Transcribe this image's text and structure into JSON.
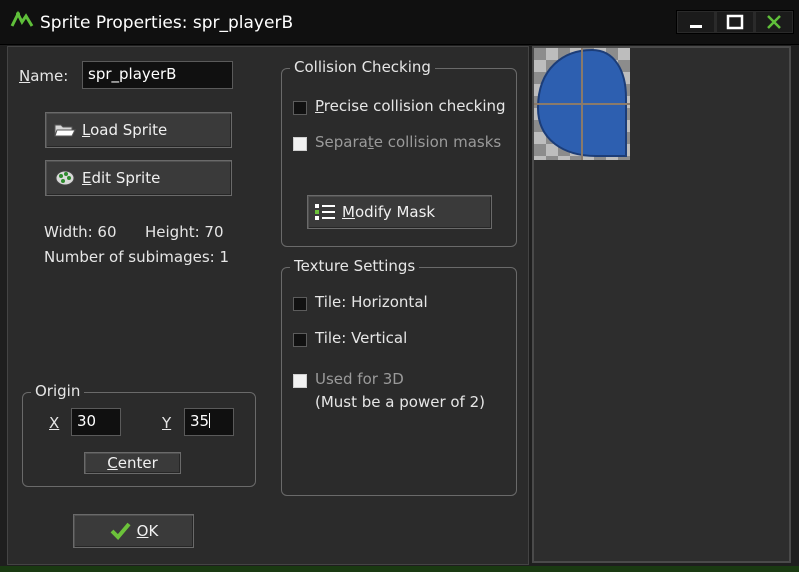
{
  "window": {
    "title": "Sprite Properties: spr_playerB"
  },
  "name_field": {
    "label": "Name:",
    "value": "spr_playerB"
  },
  "buttons": {
    "load_sprite": "Load Sprite",
    "edit_sprite": "Edit Sprite",
    "modify_mask": "Modify Mask",
    "center": "Center",
    "ok": "OK"
  },
  "info": {
    "width": "Width: 60",
    "height": "Height: 70",
    "subimages": "Number of subimages: 1"
  },
  "origin": {
    "title": "Origin",
    "x_label": "X",
    "x_value": "30",
    "y_label": "Y",
    "y_value": "35"
  },
  "collision": {
    "title": "Collision Checking",
    "precise": "Precise collision checking",
    "precise_checked": false,
    "separate": "Separate collision masks",
    "separate_enabled": false
  },
  "texture": {
    "title": "Texture Settings",
    "tile_h": "Tile: Horizontal",
    "tile_v": "Tile: Vertical",
    "used_3d": "Used for 3D",
    "power_note": "(Must be a power of 2)",
    "used_3d_enabled": false
  },
  "colors": {
    "background": "#2b2b2b",
    "sprite_fill": "#2d5fb0",
    "app_icon_green": "#5fbf3a",
    "ok_check_green": "#6cc23a"
  },
  "icons": {
    "app": "gamemaker-logo-icon",
    "load": "folder-open-icon",
    "edit": "palette-icon",
    "mask": "mask-list-icon",
    "ok": "checkmark-icon"
  }
}
